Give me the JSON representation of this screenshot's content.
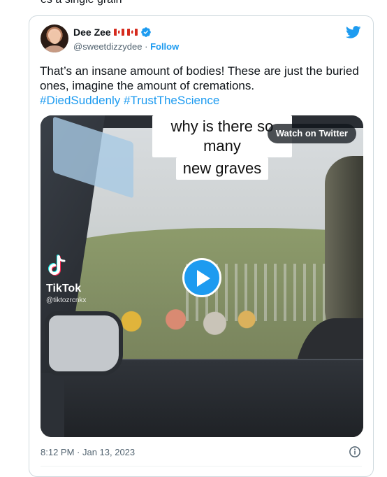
{
  "page": {
    "top_fragment": "es a single grain"
  },
  "author": {
    "display_name": "Dee Zee",
    "handle": "@sweetdizzydee",
    "separator": "·",
    "follow_label": "Follow",
    "verified_icon": "verified-badge-icon",
    "flag_icon": "canada-flag-icon"
  },
  "tweet": {
    "text": "That’s an insane amount of bodies! These are just the buried ones, imagine the amount of cremations.",
    "hashtags": [
      "#DiedSuddenly",
      "#TrustTheScience"
    ],
    "timestamp": "8:12 PM · Jan 13, 2023"
  },
  "media": {
    "caption_lines": [
      "why is there so many",
      "new graves"
    ],
    "watch_label": "Watch on Twitter",
    "tiktok_label": "TikTok",
    "tiktok_handle": "@tiktozrcnkx",
    "play_icon": "play-icon"
  },
  "colors": {
    "accent": "#1d9bf0",
    "text": "#0f1419",
    "secondary_text": "#536471",
    "border": "#cfd9de"
  }
}
